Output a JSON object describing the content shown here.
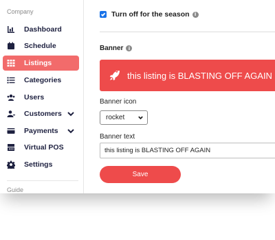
{
  "sidebar": {
    "section_company": "Company",
    "section_guide": "Guide",
    "items": [
      {
        "label": "Dashboard",
        "icon": "dashboard-icon"
      },
      {
        "label": "Schedule",
        "icon": "calendar-icon"
      },
      {
        "label": "Listings",
        "icon": "grid-icon",
        "active": true
      },
      {
        "label": "Categories",
        "icon": "list-icon"
      },
      {
        "label": "Users",
        "icon": "users-icon"
      },
      {
        "label": "Customers",
        "icon": "customers-icon",
        "expandable": true
      },
      {
        "label": "Payments",
        "icon": "payments-icon",
        "expandable": true
      },
      {
        "label": "Virtual POS",
        "icon": "pos-icon"
      },
      {
        "label": "Settings",
        "icon": "gear-icon"
      }
    ]
  },
  "main": {
    "season_toggle_label": "Turn off for the season",
    "season_toggle_checked": true,
    "banner_heading": "Banner",
    "banner_preview_text": "this listing is BLASTING OFF AGAIN",
    "banner_preview_icon": "rocket-icon",
    "banner_icon_label": "Banner icon",
    "banner_icon_value": "rocket",
    "banner_text_label": "Banner text",
    "banner_text_value": "this listing is BLASTING OFF AGAIN",
    "save_label": "Save",
    "info_glyph": "i"
  },
  "colors": {
    "accent": "#ee4b4b",
    "active_nav": "#f26b6b",
    "nav_text": "#1e2140",
    "checkbox": "#1a73e8"
  }
}
